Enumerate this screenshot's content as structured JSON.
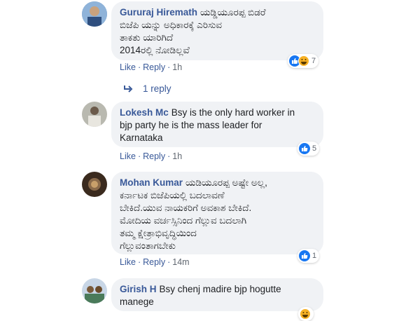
{
  "comments": [
    {
      "author": "Gururaj Hiremath",
      "text_lines": [
        "ಯಡ್ಡಿಯೂರಪ್ಪ ಬಿಡರೆ",
        "ಬಿಜೆಪಿ ಯನ್ನು ಅಧಿಕಾರಕ್ಕೆ ಎರಿಸುವ",
        "ತಾಕತು ಯಾರಿಗಿದೆ",
        "2014ರಲ್ಲಿ ನೋಡಿಲ್ಲವೆ"
      ],
      "like": "Like",
      "reply": "Reply",
      "time": "1h",
      "reactions": [
        "like-icon",
        "haha-icon"
      ],
      "reaction_count": "7",
      "replies_label": "1 reply"
    },
    {
      "author": "Lokesh Mc",
      "text_lines": [
        "Bsy is the only hard worker in",
        "bjp party he is the mass leader for",
        "Karnataka"
      ],
      "like": "Like",
      "reply": "Reply",
      "time": "1h",
      "reactions": [
        "like-icon"
      ],
      "reaction_count": "5"
    },
    {
      "author": "Mohan Kumar",
      "text_lines": [
        "ಯಡಿಯೂರಪ್ಪ ಅಷ್ಟೇ ಅಲ್ಲ,",
        "ಕರ್ನಾಟಕ ಬಿಜೆಪಿಯಲ್ಲಿ ಬದಲಾವಣೆ",
        "ಬೇಕಿದೆ.ಯುವ ನಾಯಕರಿಗೆ ಅವಕಾಶ ಬೇಕಿದೆ.",
        "ಮೋದಿಯ ವರ್ಚಸ್ಸಿನಿಂದ ಗೆಲ್ಲುವ ಬದಲಾಗಿ",
        "ತಮ್ಮ ಕ್ಷೇತ್ರಾಭಿವೃದ್ಧಿಯಿಂದ",
        "ಗೆಲ್ಲುವಂತಾಗಬೇಕು"
      ],
      "like": "Like",
      "reply": "Reply",
      "time": "14m",
      "reactions": [
        "like-icon"
      ],
      "reaction_count": "1"
    },
    {
      "author": "Girish H",
      "text_lines": [
        "Bsy chenj madire bjp hogutte",
        "manege"
      ],
      "reactions": [
        "haha-icon"
      ]
    }
  ],
  "colors": {
    "link": "#385898",
    "bubble": "#f0f2f5",
    "like": "#1877f2",
    "haha": "#f7b125"
  }
}
